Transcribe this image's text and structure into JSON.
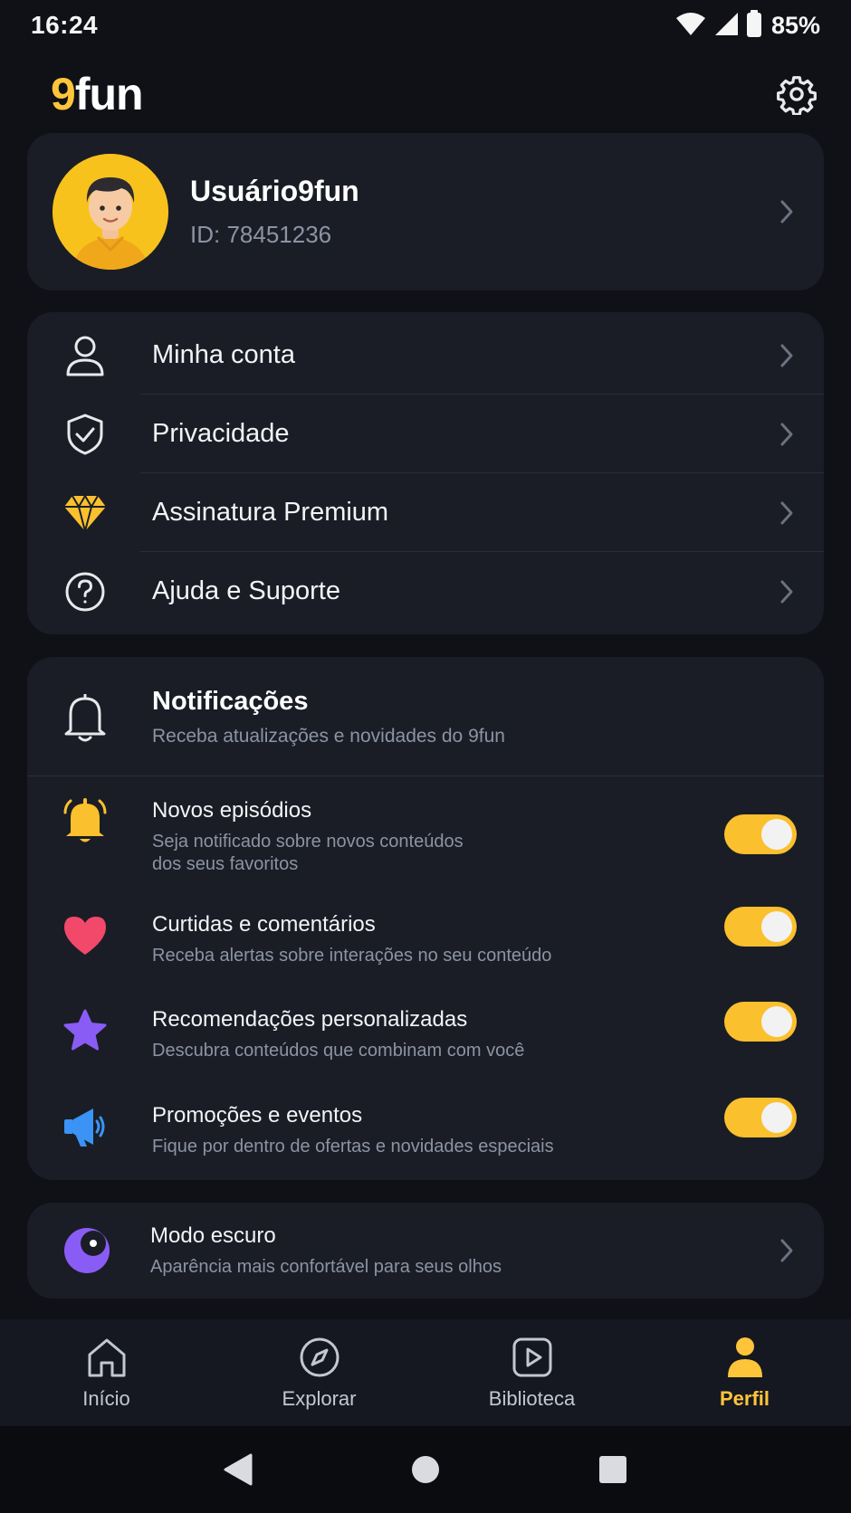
{
  "status_bar": {
    "time": "16:24",
    "battery": "85%"
  },
  "header": {
    "logo_accent": "9",
    "logo_main": "fun"
  },
  "profile": {
    "name": "Usuário9fun",
    "id": "ID: 78451236"
  },
  "menu": [
    {
      "label": "Minha conta",
      "icon": "user-icon"
    },
    {
      "label": "Privacidade",
      "icon": "shield-check-icon"
    },
    {
      "label": "Assinatura Premium",
      "icon": "diamond-icon"
    },
    {
      "label": "Ajuda e Suporte",
      "icon": "help-circle-icon"
    }
  ],
  "notifications": {
    "title": "Notificações",
    "subtitle": "Receba atualizações e novidades do 9fun",
    "items": [
      {
        "title": "Novos episódios",
        "subtitle_line1": "Seja notificado sobre novos conteúdos",
        "subtitle_line2": "dos seus favoritos",
        "enabled": true
      },
      {
        "title": "Curtidas e comentários",
        "subtitle_line1": "Receba alertas sobre interações no seu conteúdo",
        "enabled": true
      },
      {
        "title": "Recomendações personalizadas",
        "subtitle_line1": "Descubra conteúdos que combinam com você",
        "enabled": true
      },
      {
        "title": "Promoções e eventos",
        "subtitle_line1": "Fique por dentro de ofertas e novidades especiais",
        "enabled": true
      }
    ]
  },
  "dark_mode": {
    "title": "Modo escuro",
    "subtitle": "Aparência mais confortável para seus olhos"
  },
  "bottom_nav": [
    {
      "label": "Início",
      "icon": "home-icon",
      "active": false
    },
    {
      "label": "Explorar",
      "icon": "compass-icon",
      "active": false
    },
    {
      "label": "Biblioteca",
      "icon": "library-play-icon",
      "active": false
    },
    {
      "label": "Perfil",
      "icon": "profile-icon",
      "active": true
    }
  ],
  "colors": {
    "accent": "#ffc53a",
    "toggle_on": "#fbc02d",
    "background": "#0f1117",
    "card": "#1a1d26"
  }
}
